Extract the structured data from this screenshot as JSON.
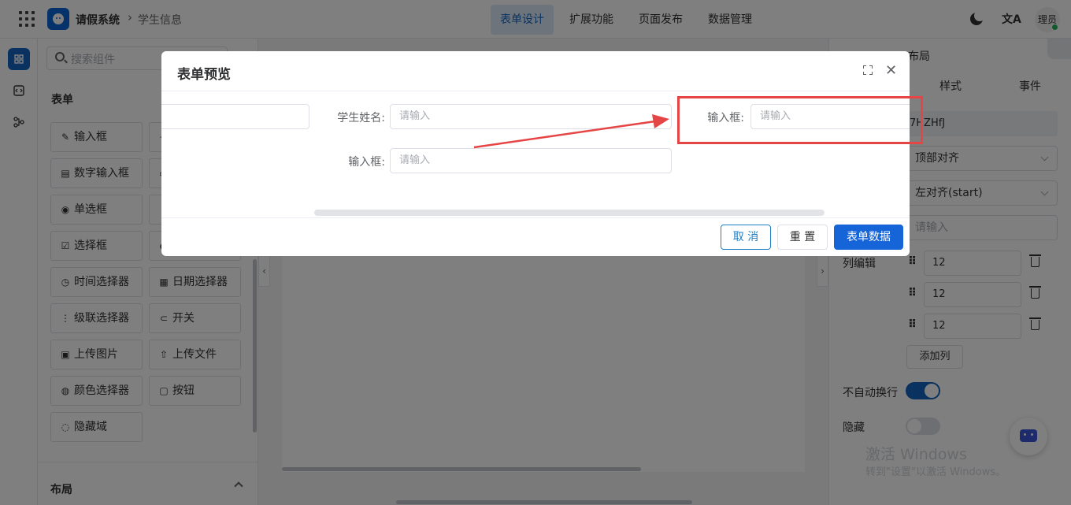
{
  "header": {
    "app_name": "请假系统",
    "breadcrumb_sep": "›",
    "breadcrumb": "学生信息",
    "tabs": [
      "表单设计",
      "扩展功能",
      "页面发布",
      "数据管理"
    ],
    "active_tab": 0,
    "lang_icon": "文A",
    "user": "理员"
  },
  "sidebar": {
    "search_placeholder": "搜索组件",
    "form_group": "表单",
    "components": [
      {
        "icon": "✎",
        "label": "输入框"
      },
      {
        "icon": "▤",
        "label": "数字输入框"
      },
      {
        "icon": "◉",
        "label": "单选框"
      },
      {
        "icon": "☑",
        "label": "选择框"
      },
      {
        "icon": "◷",
        "label": "时间选择器"
      },
      {
        "icon": "▦",
        "label": "日期选择器"
      },
      {
        "icon": "⋮",
        "label": "级联选择器"
      },
      {
        "icon": "⊂",
        "label": "开关"
      },
      {
        "icon": "▣",
        "label": "上传图片"
      },
      {
        "icon": "⇧",
        "label": "上传文件"
      },
      {
        "icon": "◍",
        "label": "颜色选择器"
      },
      {
        "icon": "▢",
        "label": "按钮"
      },
      {
        "icon": "◌",
        "label": "隐藏域"
      }
    ],
    "layout_group": "布局"
  },
  "right_panel": {
    "header_partial": "布局",
    "tab_style": "样式",
    "tab_event": "事件",
    "id_value": "7HZHfJ",
    "align_select": "顶部对齐",
    "justify_select": "左对齐(start)",
    "input_placeholder": "请输入",
    "columns_label": "列编辑",
    "columns": [
      "12",
      "12",
      "12"
    ],
    "add_column": "添加列",
    "nowrap_label": "不自动换行",
    "hidden_label": "隐藏"
  },
  "watermark": {
    "line1": "激活 Windows",
    "line2": "转到\"设置\"以激活 Windows。"
  },
  "dialog": {
    "title": "表单预览",
    "fields": [
      {
        "label": "学生姓名:",
        "placeholder": "请输入"
      },
      {
        "label": "输入框:",
        "placeholder": "请输入"
      },
      {
        "label": "输入框:",
        "placeholder": "请输入"
      }
    ],
    "cancel": "取 消",
    "reset": "重 置",
    "submit": "表单数据"
  },
  "colors": {
    "primary": "#1565d8",
    "highlight": "#e64545"
  }
}
